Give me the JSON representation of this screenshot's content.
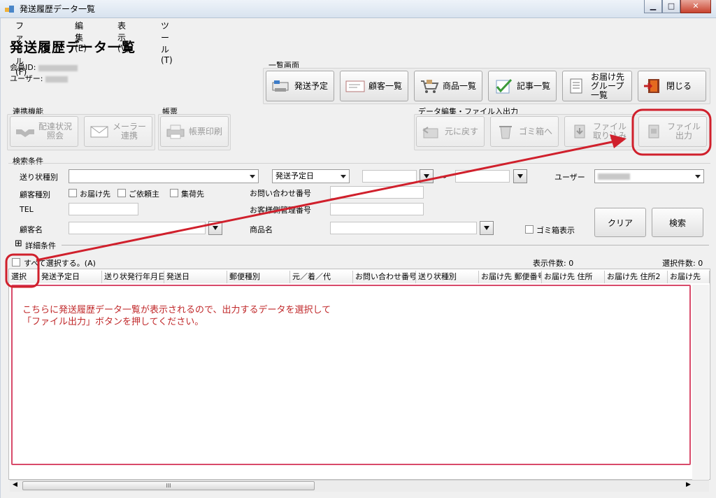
{
  "window": {
    "title": "発送履歴データ一覧",
    "minimize": "▁",
    "maximize": "□",
    "close": "✕"
  },
  "menu": {
    "file": "ファイル(F)",
    "edit": "編集(E)",
    "view": "表示(V)",
    "tools": "ツール(T)"
  },
  "page_title": "発送履歴データ一覧",
  "member": {
    "id_label": "会員ID:",
    "user_label": "ユーザー:"
  },
  "list_screen": {
    "label": "一覧画面",
    "buttons": {
      "schedule": "発送予定",
      "customers": "顧客一覧",
      "products": "商品一覧",
      "articles": "記事一覧",
      "destination_group": "お届け先グループ一覧",
      "close": "閉じる"
    }
  },
  "linkage": {
    "label": "連携機能",
    "delivery_status": "配達状況照会",
    "mailer": "メーラー連携"
  },
  "forms": {
    "label": "帳票",
    "print": "帳票印刷"
  },
  "data_edit": {
    "label": "データ編集・ファイル入出力",
    "restore": "元に戻す",
    "trash": "ゴミ箱へ",
    "file_import": "ファイル取り込み",
    "file_output": "ファイル出力"
  },
  "search": {
    "label": "検索条件",
    "slip_type_label": "送り状種別",
    "date_type_value": "発送予定日",
    "tilde": "～",
    "user_label": "ユーザー",
    "customer_type_label": "顧客種別",
    "cb_destination": "お届け先",
    "cb_requester": "ご依頼主",
    "cb_pickup": "集荷先",
    "inquiry_no_label": "お問い合わせ番号",
    "tel_label": "TEL",
    "customer_mgmt_label": "お客様側管理番号",
    "customer_name_label": "顧客名",
    "product_name_label": "商品名",
    "trash_show_label": "ゴミ箱表示",
    "clear_button": "クリア",
    "search_button": "検索"
  },
  "detail_toggle": {
    "icon": "⊞",
    "label": "詳細条件"
  },
  "grid": {
    "select_all": "すべて選択する。(A)",
    "display_count": "表示件数: 0",
    "selected_count": "選択件数: 0",
    "columns": [
      "選択",
      "発送予定日",
      "送り状発行年月日",
      "発送日",
      "郵便種別",
      "元／着／代",
      "お問い合わせ番号",
      "送り状種別",
      "お届け先 郵便番号",
      "お届け先 住所",
      "お届け先 住所2",
      "お届け先"
    ],
    "message_line1": "こちらに発送履歴データ一覧が表示されるので、出力するデータを選択して",
    "message_line2": "「ファイル出力」ボタンを押してください。",
    "scroll_thumb": "III"
  },
  "colors": {
    "annotation": "#d0202c",
    "message": "#c0282a"
  }
}
